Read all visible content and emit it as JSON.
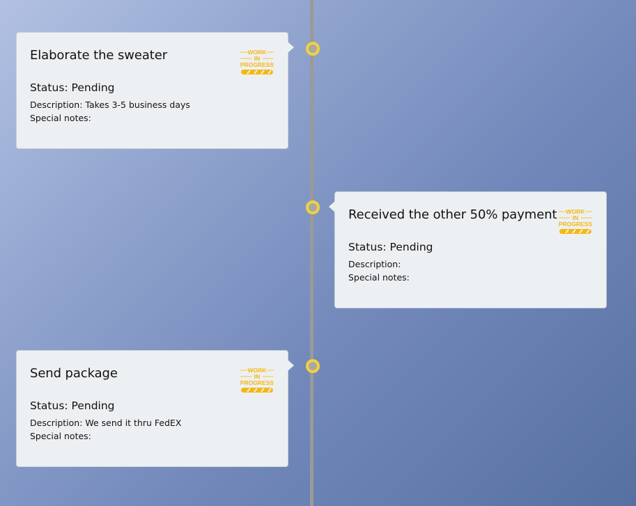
{
  "colors": {
    "badge": "#f5b80e",
    "node_ring": "#f2d13c",
    "card_bg": "#edf0f3"
  },
  "timeline": {
    "items": [
      {
        "title": "Elaborate the sweater",
        "status": "Status: Pending",
        "description": "Description: Takes 3-5 business days",
        "notes": "Special notes:",
        "side": "left",
        "badge": {
          "icon": "work-in-progress-icon",
          "line1": "WORK",
          "line2": "IN",
          "line3": "PROGRESS"
        }
      },
      {
        "title": "Received the other 50% payment",
        "status": "Status: Pending",
        "description": "Description:",
        "notes": "Special notes:",
        "side": "right",
        "badge": {
          "icon": "work-in-progress-icon",
          "line1": "WORK",
          "line2": "IN",
          "line3": "PROGRESS"
        }
      },
      {
        "title": "Send package",
        "status": "Status: Pending",
        "description": "Description: We send it thru FedEX",
        "notes": "Special notes:",
        "side": "left",
        "badge": {
          "icon": "work-in-progress-icon",
          "line1": "WORK",
          "line2": "IN",
          "line3": "PROGRESS"
        }
      }
    ]
  }
}
